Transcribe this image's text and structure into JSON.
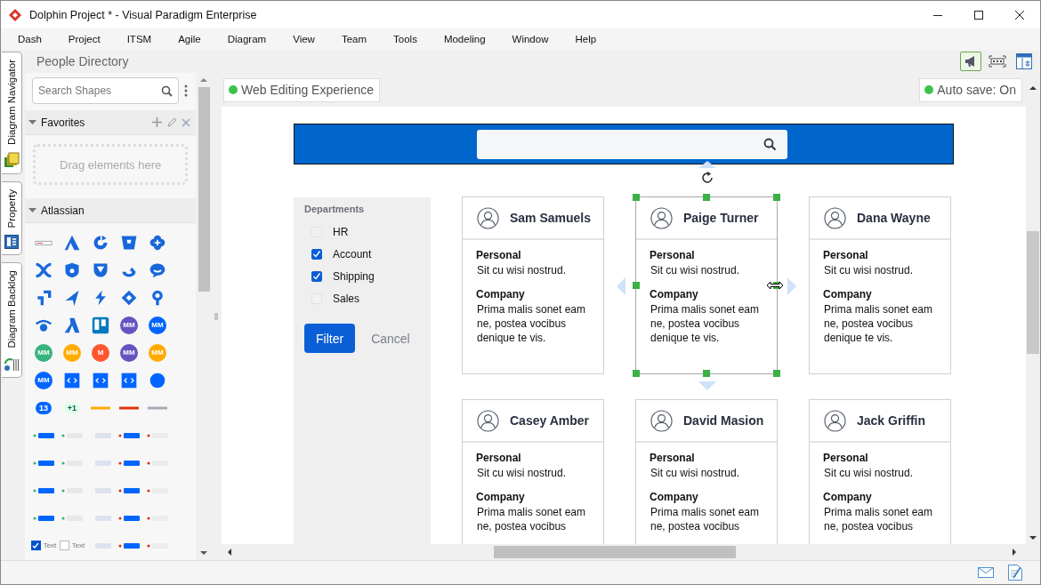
{
  "window": {
    "title": "Dolphin Project * - Visual Paradigm Enterprise"
  },
  "menu": [
    "Dash",
    "Project",
    "ITSM",
    "Agile",
    "Diagram",
    "View",
    "Team",
    "Tools",
    "Modeling",
    "Window",
    "Help"
  ],
  "side_tabs": [
    {
      "label": "Diagram Navigator",
      "kind": "navigator"
    },
    {
      "label": "Property",
      "kind": "property"
    },
    {
      "label": "Diagram Backlog",
      "kind": "backlog"
    }
  ],
  "breadcrumb": "People Directory",
  "toolbar": [
    {
      "kind": "megaphone",
      "on": true
    },
    {
      "kind": "frame",
      "on": false
    },
    {
      "kind": "panel",
      "on": false
    }
  ],
  "palette": {
    "search": {
      "placeholder": "Search Shapes"
    },
    "favorites": {
      "title": "Favorites",
      "expanded": true,
      "hint": "Drag elements here"
    },
    "group": {
      "title": "Atlassian",
      "expanded": true,
      "items": [
        {
          "kind": "bar"
        },
        {
          "kind": "triangle"
        },
        {
          "kind": "ring"
        },
        {
          "kind": "cup"
        },
        {
          "kind": "clover"
        },
        {
          "kind": "cross"
        },
        {
          "kind": "shield"
        },
        {
          "kind": "chevron"
        },
        {
          "kind": "swirl"
        },
        {
          "kind": "bubble"
        },
        {
          "kind": "arrows"
        },
        {
          "kind": "dart"
        },
        {
          "kind": "bolt"
        },
        {
          "kind": "diamond"
        },
        {
          "kind": "pin"
        },
        {
          "kind": "eye"
        },
        {
          "kind": "peak"
        },
        {
          "kind": "board"
        },
        {
          "kind": "badge",
          "label": "MM",
          "color": "#6554c0"
        },
        {
          "kind": "badge",
          "label": "MM",
          "color": "#0065ff"
        },
        {
          "kind": "badge",
          "label": "MM",
          "color": "#36b37e"
        },
        {
          "kind": "badge",
          "label": "MM",
          "color": "#ffab00"
        },
        {
          "kind": "badge",
          "label": "M",
          "color": "#ff5630"
        },
        {
          "kind": "badge",
          "label": "MM",
          "color": "#6554c0"
        },
        {
          "kind": "badge",
          "label": "MM",
          "color": "#ffab00"
        },
        {
          "kind": "badge",
          "label": "MM",
          "color": "#0065ff"
        },
        {
          "kind": "code"
        },
        {
          "kind": "code"
        },
        {
          "kind": "code"
        },
        {
          "kind": "dot"
        },
        {
          "kind": "pill",
          "label": "13",
          "color": "#0065ff"
        },
        {
          "kind": "pill",
          "label": "+1",
          "color": "#e3fcef"
        },
        {
          "kind": "line",
          "color": "#ffab00"
        },
        {
          "kind": "line",
          "color": "#de350b"
        },
        {
          "kind": "line",
          "color": "#a5adba"
        },
        {
          "kind": "widget"
        },
        {
          "kind": "widget"
        },
        {
          "kind": "widget"
        },
        {
          "kind": "widget"
        },
        {
          "kind": "widget"
        },
        {
          "kind": "widget"
        },
        {
          "kind": "widget"
        },
        {
          "kind": "widget"
        },
        {
          "kind": "widget"
        },
        {
          "kind": "widget"
        },
        {
          "kind": "widget"
        },
        {
          "kind": "widget"
        },
        {
          "kind": "widget"
        },
        {
          "kind": "widget"
        },
        {
          "kind": "widget"
        },
        {
          "kind": "widget"
        },
        {
          "kind": "widget"
        },
        {
          "kind": "widget"
        },
        {
          "kind": "widget"
        },
        {
          "kind": "widget"
        },
        {
          "kind": "checkbox",
          "label": "Text",
          "checked": true
        },
        {
          "kind": "checkbox",
          "label": "Text",
          "checked": false
        },
        {
          "kind": "widget"
        },
        {
          "kind": "widget"
        },
        {
          "kind": "widget"
        }
      ]
    }
  },
  "diagram": {
    "badges": [
      "Web Editing Experience",
      "Auto save: On"
    ]
  },
  "mockup": {
    "filter": {
      "title": "Departments",
      "options": [
        {
          "label": "HR",
          "checked": false
        },
        {
          "label": "Account",
          "checked": true
        },
        {
          "label": "Shipping",
          "checked": true
        },
        {
          "label": "Sales",
          "checked": false
        }
      ],
      "buttons": [
        {
          "label": "Filter",
          "kind": "primary"
        },
        {
          "label": "Cancel",
          "kind": "link"
        }
      ]
    },
    "cards": [
      {
        "name": "Sam Samuels",
        "selected": false,
        "sections": [
          {
            "heading": "Personal",
            "text": "Sit cu wisi nostrud."
          },
          {
            "heading": "Company",
            "text": "Prima malis sonet eam ne, postea vocibus denique te vis."
          }
        ]
      },
      {
        "name": "Paige Turner",
        "selected": true,
        "sections": [
          {
            "heading": "Personal",
            "text": "Sit cu wisi nostrud."
          },
          {
            "heading": "Company",
            "text": "Prima malis sonet eam ne, postea vocibus denique te vis."
          }
        ]
      },
      {
        "name": "Dana Wayne",
        "selected": false,
        "sections": [
          {
            "heading": "Personal",
            "text": "Sit cu wisi nostrud."
          },
          {
            "heading": "Company",
            "text": "Prima malis sonet eam ne, postea vocibus denique te vis."
          }
        ]
      },
      {
        "name": "Casey Amber",
        "selected": false,
        "sections": [
          {
            "heading": "Personal",
            "text": "Sit cu wisi nostrud."
          },
          {
            "heading": "Company",
            "text": "Prima malis sonet eam ne, postea vocibus"
          }
        ]
      },
      {
        "name": "David Masion",
        "selected": false,
        "sections": [
          {
            "heading": "Personal",
            "text": "Sit cu wisi nostrud."
          },
          {
            "heading": "Company",
            "text": "Prima malis sonet eam ne, postea vocibus"
          }
        ]
      },
      {
        "name": "Jack Griffin",
        "selected": false,
        "sections": [
          {
            "heading": "Personal",
            "text": "Sit cu wisi nostrud."
          },
          {
            "heading": "Company",
            "text": "Prima malis sonet eam ne, postea vocibus"
          }
        ]
      }
    ]
  }
}
